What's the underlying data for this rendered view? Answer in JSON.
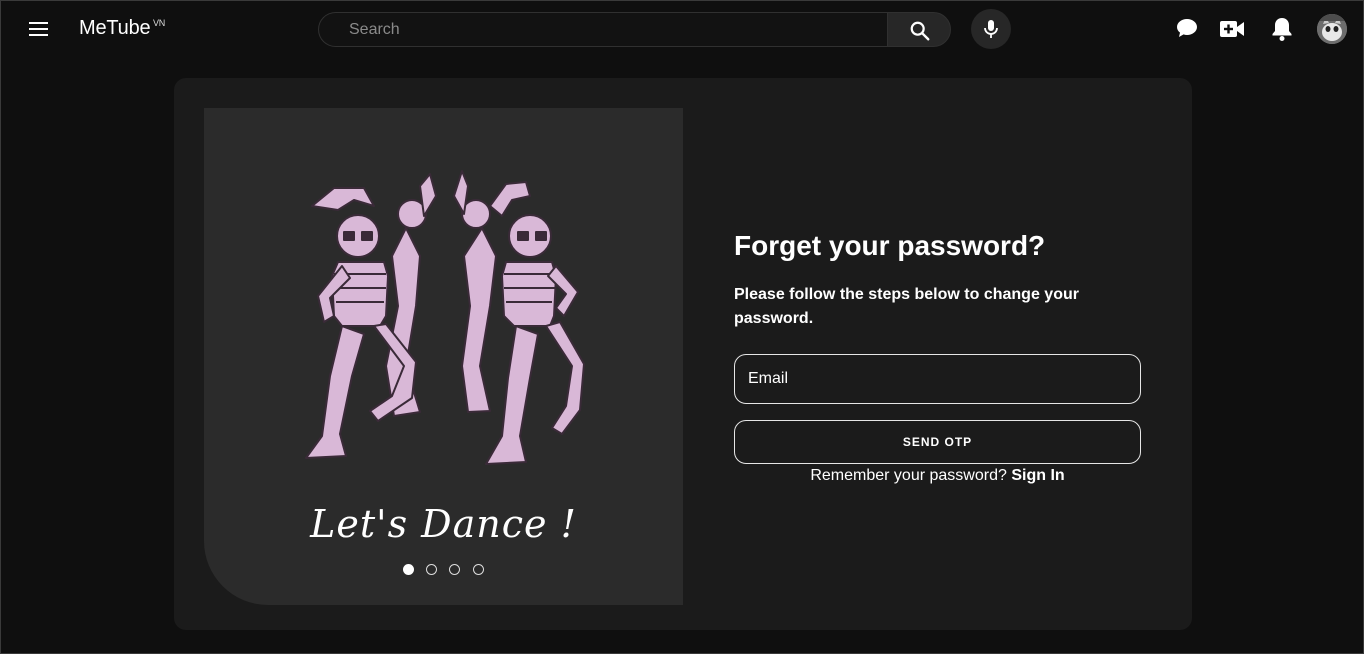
{
  "header": {
    "logo": "MeTube",
    "logo_suffix": "VN",
    "search_placeholder": "Search"
  },
  "slider": {
    "caption": "Let's Dance !",
    "dots": 4,
    "active_index": 0
  },
  "form": {
    "title": "Forget your password?",
    "subtitle": "Please follow the steps below to change your password.",
    "email_placeholder": "Email",
    "send_button": "SEND OTP",
    "remember_text": "Remember your password?",
    "sign_in_link": "Sign In"
  },
  "colors": {
    "background": "#0f0f0f",
    "card": "#1b1b1b",
    "panel": "#2b2b2b",
    "skeleton": "#d9b8d7"
  }
}
